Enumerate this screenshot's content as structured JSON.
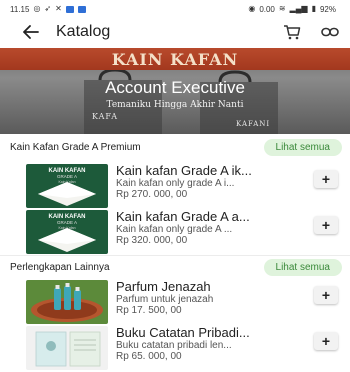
{
  "status_bar": {
    "time": "11.15",
    "right_text": "0.00",
    "battery": "92%"
  },
  "app_bar": {
    "title": "Katalog"
  },
  "banner": {
    "brand": "KAIN KAFAN",
    "heading": "Account Executive",
    "subtitle": "Temaniku Hingga Akhir Nanti",
    "logo_left": "KAFA",
    "logo_right": "KAFANI"
  },
  "sections": [
    {
      "title": "Kain Kafan Grade A Premium",
      "see_all": "Lihat semua",
      "items": [
        {
          "name": "Kain kafan Grade A ik...",
          "desc": "Kain kafan only grade A i...",
          "price": "Rp 270. 000, 00",
          "thumb_title": "KAIN KAFAN",
          "thumb_line2": "GRADE A",
          "thumb_line3": "Kain Kafan"
        },
        {
          "name": "Kain kafan Grade A a...",
          "desc": "Kain kafan only grade A ...",
          "price": "Rp 320. 000, 00",
          "thumb_title": "KAIN KAFAN",
          "thumb_line2": "GRADE A",
          "thumb_line3": "Kain Kafan"
        }
      ]
    },
    {
      "title": "Perlengkapan Lainnya",
      "see_all": "Lihat semua",
      "items": [
        {
          "name": "Parfum Jenazah",
          "desc": "Parfum untuk jenazah",
          "price": "Rp 17. 500, 00"
        },
        {
          "name": "Buku Catatan Pribadi...",
          "desc": "Buku catatan pribadi len...",
          "price": "Rp 65. 000, 00"
        }
      ]
    }
  ],
  "add_label": "+",
  "colors": {
    "accent_green": "#3b8a3b",
    "pill_bg": "#dff3dc",
    "banner_ribbon": "#a3381e"
  }
}
